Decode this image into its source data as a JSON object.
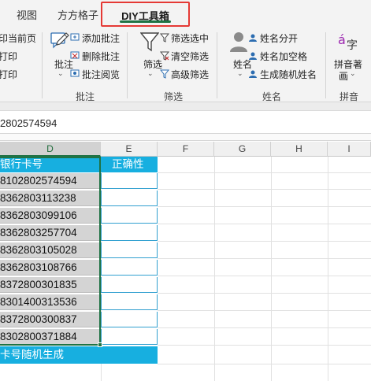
{
  "tabs": [
    {
      "label": "视图"
    },
    {
      "label": "方方格子"
    },
    {
      "label": "DIY工具箱",
      "active": true
    }
  ],
  "ribbon": {
    "print_group": {
      "items": [
        "印当前页",
        "打印",
        "打印"
      ]
    },
    "annotation_group": {
      "big_button": "批注",
      "items": [
        "添加批注",
        "删除批注",
        "批注阅览"
      ],
      "label": "批注"
    },
    "filter_group": {
      "big_button": "筛选",
      "items": [
        "筛选选中",
        "清空筛选",
        "高级筛选"
      ],
      "label": "筛选"
    },
    "name_group": {
      "big_button": "姓名",
      "items": [
        "姓名分开",
        "姓名加空格",
        "生成随机姓名"
      ],
      "label": "姓名"
    },
    "pinyin_group": {
      "big_button_line1": "拼音著",
      "big_button_line2": "画",
      "label": "拼音"
    }
  },
  "formula_bar": {
    "value": "2802574594"
  },
  "columns": [
    "D",
    "E",
    "F",
    "G",
    "H",
    "I"
  ],
  "sheet": {
    "d_header": "银行卡号",
    "e_header": "正确性",
    "card_numbers": [
      "8102802574594",
      "8362803113238",
      "8362803099106",
      "8362803257704",
      "8362803105028",
      "8362803108766",
      "8372800301835",
      "8301400313536",
      "8372800300837",
      "8302800371884"
    ],
    "footer": "卡号随机生成"
  },
  "colors": {
    "accent_green": "#1f7244",
    "header_blue": "#17afe0",
    "highlight_red": "#e53935"
  }
}
